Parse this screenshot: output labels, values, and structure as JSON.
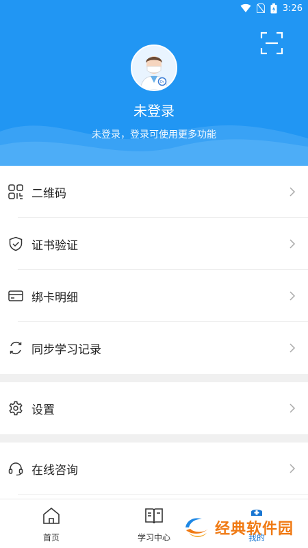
{
  "status_bar": {
    "time": "3:26"
  },
  "header": {
    "title": "未登录",
    "subtitle": "未登录，登录可使用更多功能"
  },
  "menu": {
    "items": [
      {
        "label": "二维码",
        "icon": "qr-code-icon"
      },
      {
        "label": "证书验证",
        "icon": "shield-check-icon"
      },
      {
        "label": "绑卡明细",
        "icon": "card-icon"
      },
      {
        "label": "同步学习记录",
        "icon": "sync-icon"
      }
    ],
    "settings": {
      "label": "设置",
      "icon": "gear-icon"
    },
    "consult": {
      "label": "在线咨询",
      "icon": "headset-icon"
    }
  },
  "bottom_nav": {
    "items": [
      {
        "label": "首页",
        "icon": "home-icon"
      },
      {
        "label": "学习中心",
        "icon": "book-icon"
      },
      {
        "label": "我的",
        "icon": "nurse-cap-icon"
      }
    ]
  },
  "watermark": {
    "text": "经典软件园"
  },
  "colors": {
    "primary": "#2196f3",
    "accent_watermark": "#f07a14",
    "divider": "#eeeeee"
  }
}
